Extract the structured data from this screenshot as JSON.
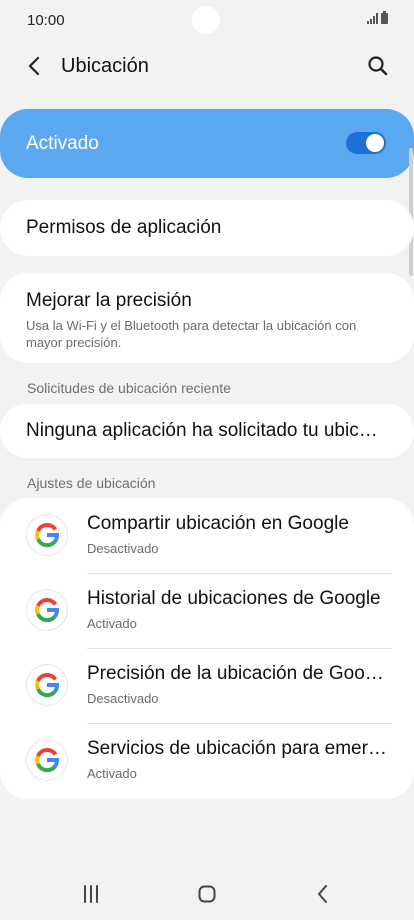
{
  "status_bar": {
    "time": "10:00"
  },
  "app_bar": {
    "title": "Ubicación",
    "back_icon": "chevron-left-icon",
    "search_icon": "search-icon"
  },
  "master": {
    "label": "Activado",
    "enabled": true,
    "accent": "#5ba7f0",
    "toggle_color": "#1e6fd6"
  },
  "items": {
    "permissions": {
      "title": "Permisos de aplicación"
    },
    "accuracy": {
      "title": "Mejorar la precisión",
      "subtitle": "Usa la Wi-Fi y el Bluetooth para detectar la ubicación con mayor precisión."
    }
  },
  "recent": {
    "header": "Solicitudes de ubicación reciente",
    "empty_text": "Ninguna aplicación ha solicitado tu ubicación recientemente"
  },
  "settings": {
    "header": "Ajustes de ubicación",
    "rows": [
      {
        "title": "Compartir ubicación en Google",
        "status": "Desactivado",
        "icon": "google-icon"
      },
      {
        "title": "Historial de ubicaciones de Google",
        "status": "Activado",
        "icon": "google-icon"
      },
      {
        "title": "Precisión de la ubicación de Google",
        "status": "Desactivado",
        "icon": "google-icon"
      },
      {
        "title": "Servicios de ubicación para emergencias",
        "status": "Activado",
        "icon": "google-icon"
      }
    ]
  },
  "nav": {
    "recents_icon": "recents-icon",
    "home_icon": "home-icon",
    "back_icon": "back-icon"
  }
}
